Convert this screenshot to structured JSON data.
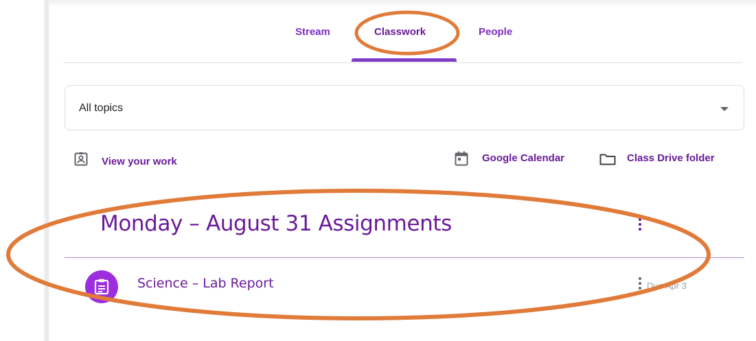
{
  "tabs": [
    {
      "label": "Stream"
    },
    {
      "label": "Classwork",
      "active": true
    },
    {
      "label": "People"
    }
  ],
  "topics_filter": {
    "selected": "All topics"
  },
  "links": {
    "view_work": "View your work",
    "calendar": "Google Calendar",
    "drive": "Class Drive folder"
  },
  "section": {
    "title": "Monday – August 31 Assignments",
    "items": [
      {
        "title": "Science – Lab Report",
        "due": "Due Apr 3"
      }
    ]
  },
  "colors": {
    "accent": "#6a1b9a",
    "tab_underline": "#7e3ac5",
    "assignment_icon": "#9c2ee0",
    "annotation": "#e07b39"
  },
  "icons": [
    "assignment-ind-icon",
    "calendar-icon",
    "folder-icon",
    "kebab-menu-icon",
    "assignment-icon",
    "dropdown-arrow-icon"
  ]
}
